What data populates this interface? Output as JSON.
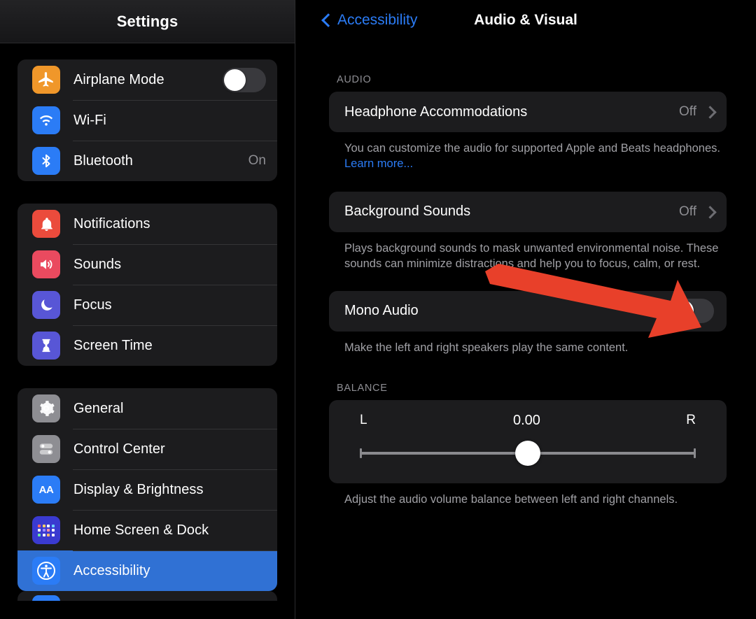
{
  "colors": {
    "accent_blue": "#2b7cf6",
    "selected_row": "#3071d4",
    "card_bg": "#1c1c1e",
    "page_bg": "#000000",
    "secondary_text": "#8e8e93",
    "annotation_red": "#e8402a",
    "toggle_off_track": "#39393d"
  },
  "sidebar": {
    "header_title": "Settings",
    "groups": [
      {
        "items": [
          {
            "label": "Airplane Mode",
            "icon": "airplane-icon",
            "control": "toggle",
            "toggle_on": false
          },
          {
            "label": "Wi-Fi",
            "icon": "wifi-icon",
            "control": "none",
            "value": ""
          },
          {
            "label": "Bluetooth",
            "icon": "bluetooth-icon",
            "control": "value",
            "value": "On"
          }
        ]
      },
      {
        "items": [
          {
            "label": "Notifications",
            "icon": "bell-icon",
            "control": "none",
            "value": ""
          },
          {
            "label": "Sounds",
            "icon": "speaker-icon",
            "control": "none",
            "value": ""
          },
          {
            "label": "Focus",
            "icon": "moon-icon",
            "control": "none",
            "value": ""
          },
          {
            "label": "Screen Time",
            "icon": "hourglass-icon",
            "control": "none",
            "value": ""
          }
        ]
      },
      {
        "items": [
          {
            "label": "General",
            "icon": "gear-icon",
            "control": "none",
            "value": ""
          },
          {
            "label": "Control Center",
            "icon": "sliders-icon",
            "control": "none",
            "value": ""
          },
          {
            "label": "Display & Brightness",
            "icon": "aa-text-icon",
            "control": "none",
            "value": ""
          },
          {
            "label": "Home Screen & Dock",
            "icon": "app-grid-icon",
            "control": "none",
            "value": ""
          },
          {
            "label": "Accessibility",
            "icon": "accessibility-icon",
            "control": "none",
            "value": "",
            "selected": true
          }
        ]
      }
    ]
  },
  "detail": {
    "back_label": "Accessibility",
    "title": "Audio & Visual",
    "audio_section_label": "AUDIO",
    "headphone": {
      "label": "Headphone Accommodations",
      "value": "Off",
      "footnote_before": "You can customize the audio for supported Apple and Beats headphones. ",
      "footnote_link": "Learn more..."
    },
    "background_sounds": {
      "label": "Background Sounds",
      "value": "Off",
      "footnote": "Plays background sounds to mask unwanted environmental noise. These sounds can minimize distractions and help you to focus, calm, or rest."
    },
    "mono_audio": {
      "label": "Mono Audio",
      "toggle_on": false,
      "footnote": "Make the left and right speakers play the same content."
    },
    "balance": {
      "section_label": "BALANCE",
      "left_label": "L",
      "right_label": "R",
      "value": "0.00",
      "footnote": "Adjust the audio volume balance between left and right channels."
    }
  }
}
